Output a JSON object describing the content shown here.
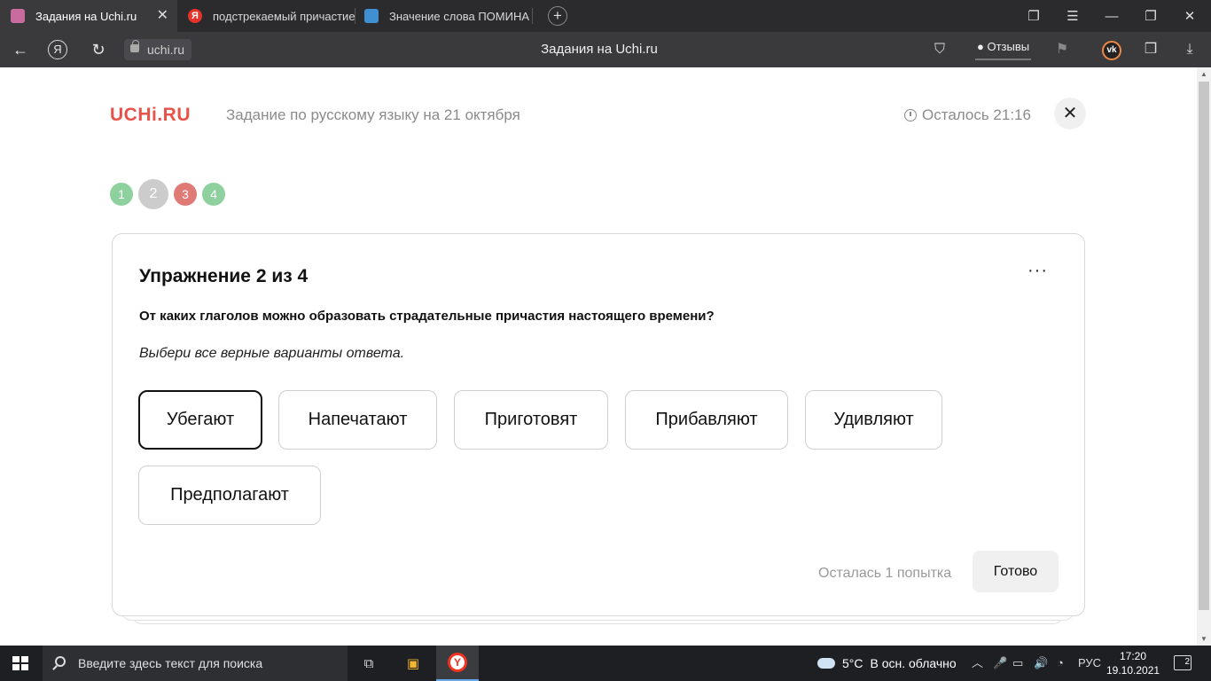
{
  "tabs": [
    {
      "title": "Задания на Uchi.ru",
      "favicon_color": "#c86b9e"
    },
    {
      "title": "подстрекаемый причастие",
      "favicon_color": "#e5342a",
      "favicon_glyph": "Я"
    },
    {
      "title": "Значение слова ПОМИНА",
      "favicon_color": "#3f8fd2"
    }
  ],
  "tab_close_glyph": "✕",
  "newtab_glyph": "+",
  "window_controls": {
    "collections": "❐",
    "menu": "☰",
    "minimize": "—",
    "restore": "❐",
    "close": "✕"
  },
  "address": {
    "url": "uchi.ru",
    "page_title": "Задания на Uchi.ru",
    "reviews_label": "Отзывы",
    "badge_count": "1"
  },
  "nav_icons": {
    "back": "←",
    "yandex": "Я",
    "reload": "↻"
  },
  "header": {
    "logo": "UCHi.RU",
    "task_title": "Задание по русскому языку на 21 октября",
    "timer_text": "Осталось 21:16",
    "close_glyph": "✕"
  },
  "steps": [
    {
      "num": "1",
      "color": "#8fd19e",
      "current": false
    },
    {
      "num": "2",
      "color": "#cccccc",
      "current": true
    },
    {
      "num": "3",
      "color": "#e07a76",
      "current": false
    },
    {
      "num": "4",
      "color": "#8fd19e",
      "current": false
    }
  ],
  "exercise": {
    "heading": "Упражнение 2 из 4",
    "more_glyph": "···",
    "question": "От каких глаголов можно образовать страдательные причастия настоящего времени?",
    "hint": "Выбери все верные варианты ответа.",
    "options": [
      {
        "label": "Убегают",
        "selected": true
      },
      {
        "label": "Напечатают",
        "selected": false
      },
      {
        "label": "Приготовят",
        "selected": false
      },
      {
        "label": "Прибавляют",
        "selected": false
      },
      {
        "label": "Удивляют",
        "selected": false
      },
      {
        "label": "Предполагают",
        "selected": false
      }
    ],
    "attempts_text": "Осталась 1 попытка",
    "done_label": "Готово"
  },
  "taskbar": {
    "search_placeholder": "Введите здесь текст для поиска",
    "weather_temp": "5°C",
    "weather_desc": "В осн. облачно",
    "language": "РУС",
    "time": "17:20",
    "date": "19.10.2021",
    "notifications": "2"
  }
}
